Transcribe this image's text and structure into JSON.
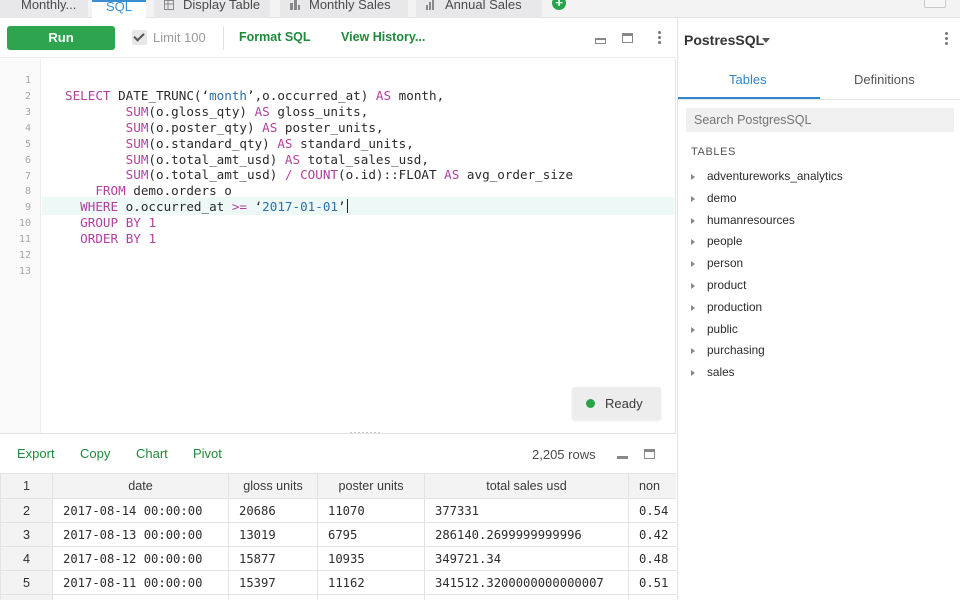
{
  "tabs": [
    {
      "label": "Monthly...",
      "icon": "none",
      "active": false
    },
    {
      "label": "SQL",
      "icon": "none",
      "active": true
    },
    {
      "label": "Display Table",
      "icon": "table-icon",
      "active": false
    },
    {
      "label": "Monthly Sales",
      "icon": "bar-chart-icon",
      "active": false
    },
    {
      "label": "Annual Sales",
      "icon": "column-chart-icon",
      "active": false
    }
  ],
  "toolbar": {
    "run_label": "Run",
    "limit_label": "Limit 100",
    "limit_checked": true,
    "format_label": "Format SQL",
    "history_label": "View History..."
  },
  "editor": {
    "line_numbers": [
      "1",
      "2",
      "3",
      "4",
      "5",
      "6",
      "7",
      "8",
      "9",
      "10",
      "11",
      "12",
      "13"
    ],
    "active_line": 9,
    "lines": [
      "",
      "SELECT DATE_TRUNC(‘month’,o.occurred_at) AS month,",
      "        SUM(o.gloss_qty) AS gloss_units,",
      "        SUM(o.poster_qty) AS poster_units,",
      "        SUM(o.standard_qty) AS standard_units,",
      "        SUM(o.total_amt_usd) AS total_sales_usd,",
      "        SUM(o.total_amt_usd) / COUNT(o.id)::FLOAT AS avg_order_size",
      "    FROM demo.orders o",
      "  WHERE o.occurred_at >= ‘2017-01-01’",
      "  GROUP BY 1",
      "  ORDER BY 1",
      "",
      ""
    ],
    "status": "Ready",
    "status_color": "#27a349"
  },
  "results": {
    "actions": [
      "Export",
      "Copy",
      "Chart",
      "Pivot"
    ],
    "row_count": "2,205 rows",
    "columns": [
      "",
      "date",
      "gloss units",
      "poster units",
      "total sales usd",
      "non"
    ],
    "rows": [
      [
        "2",
        "2017-08-14 00:00:00",
        "20686",
        "11070",
        "377331",
        "0.54"
      ],
      [
        "3",
        "2017-08-13 00:00:00",
        "13019",
        "6795",
        "286140.2699999999996",
        "0.42"
      ],
      [
        "4",
        "2017-08-12 00:00:00",
        "15877",
        "10935",
        "349721.34",
        "0.48"
      ],
      [
        "5",
        "2017-08-11 00:00:00",
        "15397",
        "11162",
        "341512.3200000000000007",
        "0.51"
      ]
    ],
    "header_row_number": "1"
  },
  "schema_panel": {
    "database": "PostresSQL",
    "tabs": [
      "Tables",
      "Definitions"
    ],
    "active_tab": "Tables",
    "search_placeholder": "Search PostgresSQL",
    "section_heading": "TABLES",
    "schemas": [
      "adventureworks_analytics",
      "demo",
      "humanresources",
      "people",
      "person",
      "product",
      "production",
      "public",
      "purchasing",
      "sales"
    ]
  },
  "colors": {
    "accent_green": "#2ea44f",
    "link_green": "#1f8a3a",
    "active_blue": "#2f86c9",
    "keyword_purple": "#b03fa0",
    "string_blue": "#2c6fae"
  }
}
